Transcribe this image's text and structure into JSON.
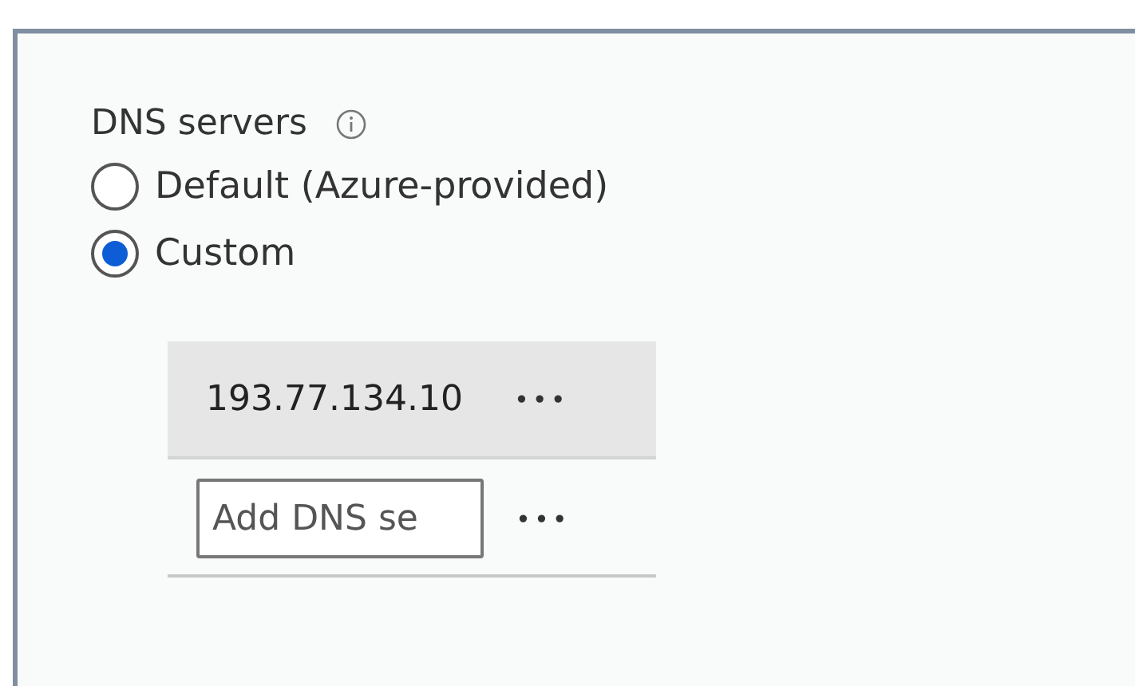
{
  "dns_servers": {
    "label": "DNS servers",
    "options": [
      {
        "label": "Default (Azure-provided)",
        "selected": false
      },
      {
        "label": "Custom",
        "selected": true
      }
    ],
    "servers": [
      {
        "address": "193.77.134.10",
        "more": "•••"
      }
    ],
    "add_field": {
      "placeholder": "Add DNS se",
      "more": "•••"
    }
  }
}
